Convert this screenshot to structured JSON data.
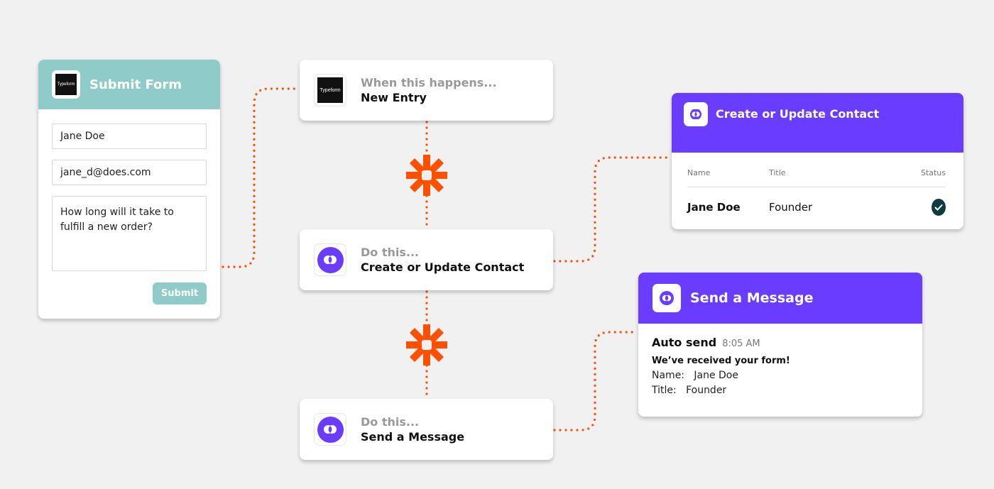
{
  "colors": {
    "background": "#f2f1f1",
    "typeform_teal": "#8ecbc9",
    "app_purple": "#6a3cff",
    "connector_orange": "#ff4f00",
    "status_check": "#0f3a3f"
  },
  "form_card": {
    "app_icon": "typeform-logo",
    "app_icon_text": "Typeform",
    "title": "Submit Form",
    "fields": {
      "name": "Jane Doe",
      "email": "jane_d@does.com",
      "message": "How long will it take to\nfulfill a new order?"
    },
    "submit_label": "Submit"
  },
  "steps": [
    {
      "icon": "typeform-logo",
      "icon_text": "Typeform",
      "label": "When this happens...",
      "action": "New Entry"
    },
    {
      "icon": "purple-app-logo",
      "label": "Do this...",
      "action": "Create or Update Contact"
    },
    {
      "icon": "purple-app-logo",
      "label": "Do this...",
      "action": "Send a Message"
    }
  ],
  "connectors": {
    "icon": "zapier-asterisk-icon"
  },
  "contact_card": {
    "title": "Create or Update Contact",
    "columns": [
      "Name",
      "Title",
      "Status"
    ],
    "rows": [
      {
        "name": "Jane Doe",
        "title": "Founder",
        "status": "check-icon"
      }
    ]
  },
  "message_card": {
    "title": "Send a Message",
    "sender": "Auto send",
    "time": "8:05 AM",
    "headline": "We’ve received your form!",
    "name_line": "Name:   Jane Doe",
    "title_line": "Title:   Founder"
  }
}
